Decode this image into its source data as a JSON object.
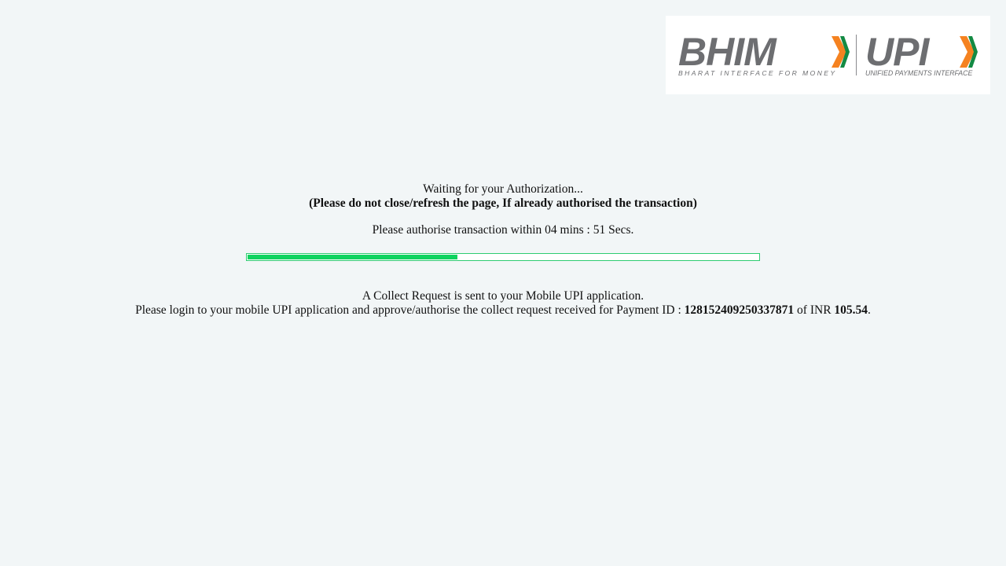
{
  "logo": {
    "bhim_text": "BHIM",
    "bhim_tagline": "BHARAT INTERFACE FOR MONEY",
    "upi_text": "UPI",
    "upi_tagline": "UNIFIED PAYMENTS INTERFACE",
    "colors": {
      "gray": "#6d6e71",
      "orange": "#f58220",
      "green": "#138a43"
    }
  },
  "status": {
    "waiting_text": "Waiting for your Authorization...",
    "warning_text": "(Please do not close/refresh the page, If already authorised the transaction)",
    "timer_prefix": "Please authorise transaction within",
    "timer_value": "04 mins : 51 Secs."
  },
  "progress": {
    "fraction": 0.41,
    "fill_color": "#0fd35f",
    "border_color": "#2ecc71"
  },
  "collect_request": {
    "line1": "A Collect Request is sent to your Mobile UPI application.",
    "line2_prefix": "Please login to your mobile UPI application and approve/authorise the collect request received for Payment ID :",
    "payment_id": "128152409250337871",
    "currency_text": "of INR",
    "amount": "105.54",
    "line2_suffix": "."
  }
}
